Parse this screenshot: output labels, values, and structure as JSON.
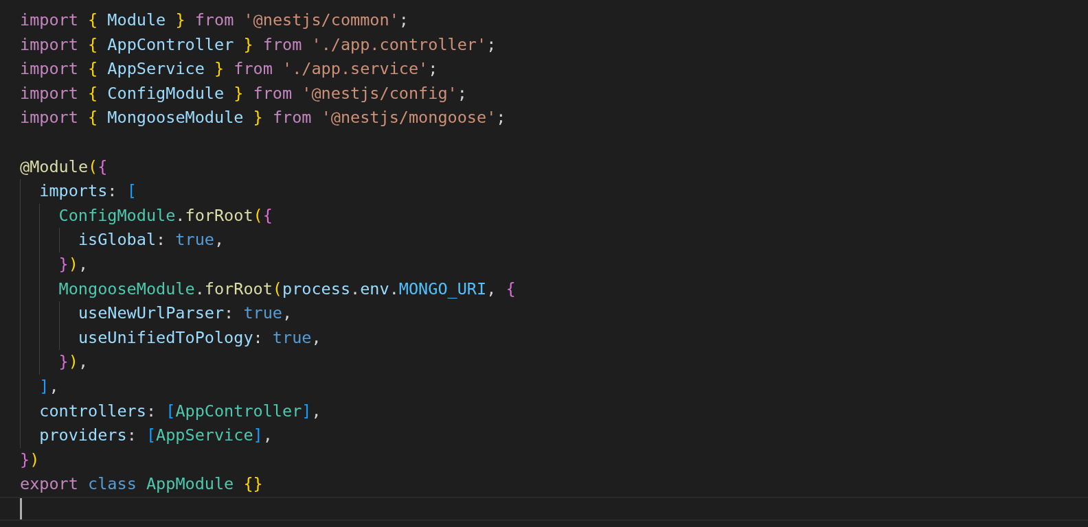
{
  "editor": {
    "lines": [
      {
        "current": false,
        "tokens": [
          {
            "kind": "keyword",
            "text": "import "
          },
          {
            "kind": "brace1",
            "text": "{"
          },
          {
            "kind": "variable",
            "text": " Module "
          },
          {
            "kind": "brace1",
            "text": "} "
          },
          {
            "kind": "keyword",
            "text": "from "
          },
          {
            "kind": "string",
            "text": "'@nestjs/common'"
          },
          {
            "kind": "plain",
            "text": ";"
          }
        ]
      },
      {
        "current": false,
        "tokens": [
          {
            "kind": "keyword",
            "text": "import "
          },
          {
            "kind": "brace1",
            "text": "{"
          },
          {
            "kind": "variable",
            "text": " AppController "
          },
          {
            "kind": "brace1",
            "text": "} "
          },
          {
            "kind": "keyword",
            "text": "from "
          },
          {
            "kind": "string",
            "text": "'./app.controller'"
          },
          {
            "kind": "plain",
            "text": ";"
          }
        ]
      },
      {
        "current": false,
        "tokens": [
          {
            "kind": "keyword",
            "text": "import "
          },
          {
            "kind": "brace1",
            "text": "{"
          },
          {
            "kind": "variable",
            "text": " AppService "
          },
          {
            "kind": "brace1",
            "text": "} "
          },
          {
            "kind": "keyword",
            "text": "from "
          },
          {
            "kind": "string",
            "text": "'./app.service'"
          },
          {
            "kind": "plain",
            "text": ";"
          }
        ]
      },
      {
        "current": false,
        "tokens": [
          {
            "kind": "keyword",
            "text": "import "
          },
          {
            "kind": "brace1",
            "text": "{"
          },
          {
            "kind": "variable",
            "text": " ConfigModule "
          },
          {
            "kind": "brace1",
            "text": "} "
          },
          {
            "kind": "keyword",
            "text": "from "
          },
          {
            "kind": "string",
            "text": "'@nestjs/config'"
          },
          {
            "kind": "plain",
            "text": ";"
          }
        ]
      },
      {
        "current": false,
        "tokens": [
          {
            "kind": "keyword",
            "text": "import "
          },
          {
            "kind": "brace1",
            "text": "{"
          },
          {
            "kind": "variable",
            "text": " MongooseModule "
          },
          {
            "kind": "brace1",
            "text": "} "
          },
          {
            "kind": "keyword",
            "text": "from "
          },
          {
            "kind": "string",
            "text": "'@nestjs/mongoose'"
          },
          {
            "kind": "plain",
            "text": ";"
          }
        ]
      },
      {
        "current": false
      },
      {
        "current": false,
        "tokens": [
          {
            "kind": "function",
            "text": "@Module"
          },
          {
            "kind": "brace1",
            "text": "("
          },
          {
            "kind": "brace2",
            "text": "{"
          }
        ]
      },
      {
        "current": false,
        "tokens": [
          {
            "kind": "variable",
            "text": "  imports"
          },
          {
            "kind": "plain",
            "text": ": "
          },
          {
            "kind": "brace3",
            "text": "["
          }
        ]
      },
      {
        "current": false,
        "tokens": [
          {
            "kind": "class",
            "text": "    ConfigModule"
          },
          {
            "kind": "plain",
            "text": "."
          },
          {
            "kind": "function",
            "text": "forRoot"
          },
          {
            "kind": "brace1",
            "text": "("
          },
          {
            "kind": "brace2",
            "text": "{"
          }
        ]
      },
      {
        "current": false,
        "tokens": [
          {
            "kind": "variable",
            "text": "      isGlobal"
          },
          {
            "kind": "plain",
            "text": ": "
          },
          {
            "kind": "storage",
            "text": "true"
          },
          {
            "kind": "plain",
            "text": ","
          }
        ]
      },
      {
        "current": false,
        "tokens": [
          {
            "kind": "brace2",
            "text": "    }"
          },
          {
            "kind": "brace1",
            "text": ")"
          },
          {
            "kind": "plain",
            "text": ","
          }
        ]
      },
      {
        "current": false,
        "tokens": [
          {
            "kind": "class",
            "text": "    MongooseModule"
          },
          {
            "kind": "plain",
            "text": "."
          },
          {
            "kind": "function",
            "text": "forRoot"
          },
          {
            "kind": "brace1",
            "text": "("
          },
          {
            "kind": "variable",
            "text": "process"
          },
          {
            "kind": "plain",
            "text": "."
          },
          {
            "kind": "variable",
            "text": "env"
          },
          {
            "kind": "plain",
            "text": "."
          },
          {
            "kind": "constant",
            "text": "MONGO_URI"
          },
          {
            "kind": "plain",
            "text": ", "
          },
          {
            "kind": "brace2",
            "text": "{"
          }
        ]
      },
      {
        "current": false,
        "tokens": [
          {
            "kind": "variable",
            "text": "      useNewUrlParser"
          },
          {
            "kind": "plain",
            "text": ": "
          },
          {
            "kind": "storage",
            "text": "true"
          },
          {
            "kind": "plain",
            "text": ","
          }
        ]
      },
      {
        "current": false,
        "tokens": [
          {
            "kind": "variable",
            "text": "      useUnifiedToPology"
          },
          {
            "kind": "plain",
            "text": ": "
          },
          {
            "kind": "storage",
            "text": "true"
          },
          {
            "kind": "plain",
            "text": ","
          }
        ]
      },
      {
        "current": false,
        "tokens": [
          {
            "kind": "brace2",
            "text": "    }"
          },
          {
            "kind": "brace1",
            "text": ")"
          },
          {
            "kind": "plain",
            "text": ","
          }
        ]
      },
      {
        "current": false,
        "tokens": [
          {
            "kind": "brace3",
            "text": "  ]"
          },
          {
            "kind": "plain",
            "text": ","
          }
        ]
      },
      {
        "current": false,
        "tokens": [
          {
            "kind": "variable",
            "text": "  controllers"
          },
          {
            "kind": "plain",
            "text": ": "
          },
          {
            "kind": "brace3",
            "text": "["
          },
          {
            "kind": "class",
            "text": "AppController"
          },
          {
            "kind": "brace3",
            "text": "]"
          },
          {
            "kind": "plain",
            "text": ","
          }
        ]
      },
      {
        "current": false,
        "tokens": [
          {
            "kind": "variable",
            "text": "  providers"
          },
          {
            "kind": "plain",
            "text": ": "
          },
          {
            "kind": "brace3",
            "text": "["
          },
          {
            "kind": "class",
            "text": "AppService"
          },
          {
            "kind": "brace3",
            "text": "]"
          },
          {
            "kind": "plain",
            "text": ","
          }
        ]
      },
      {
        "current": false,
        "tokens": [
          {
            "kind": "brace2",
            "text": "}"
          },
          {
            "kind": "brace1",
            "text": ")"
          }
        ]
      },
      {
        "current": false,
        "tokens": [
          {
            "kind": "keyword",
            "text": "export "
          },
          {
            "kind": "storage",
            "text": "class "
          },
          {
            "kind": "class",
            "text": "AppModule "
          },
          {
            "kind": "brace1",
            "text": "{}"
          }
        ]
      },
      {
        "current": true
      }
    ]
  }
}
